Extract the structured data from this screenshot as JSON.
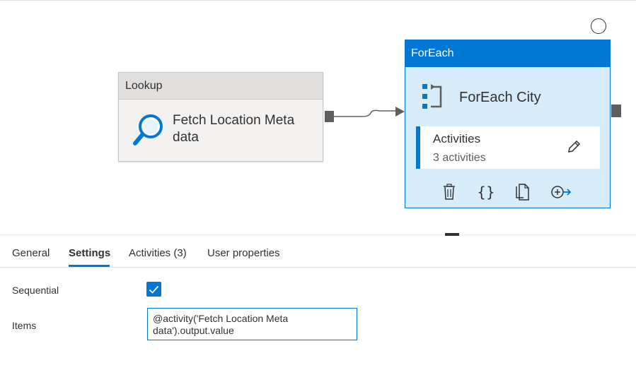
{
  "canvas": {
    "lookup": {
      "type_label": "Lookup",
      "name": "Fetch Location Meta data",
      "icon": "magnifier-icon"
    },
    "foreach": {
      "type_label": "ForEach",
      "name": "ForEach City",
      "activities_title": "Activities",
      "activities_count": "3 activities",
      "icons": [
        "foreach-icon",
        "edit-icon",
        "delete-icon",
        "code-icon",
        "copy-icon",
        "add-output-icon"
      ]
    }
  },
  "panel": {
    "tabs": [
      {
        "label": "General"
      },
      {
        "label": "Settings",
        "active": true
      },
      {
        "label": "Activities (3)"
      },
      {
        "label": "User properties"
      }
    ],
    "settings": {
      "sequential_label": "Sequential",
      "sequential_checked": true,
      "items_label": "Items",
      "items_value": "@activity('Fetch Location Meta data').output.value"
    }
  },
  "colors": {
    "accent": "#0078d4",
    "foreach_body": "#d6ecfb",
    "lookup_header": "#e1dfdd"
  }
}
